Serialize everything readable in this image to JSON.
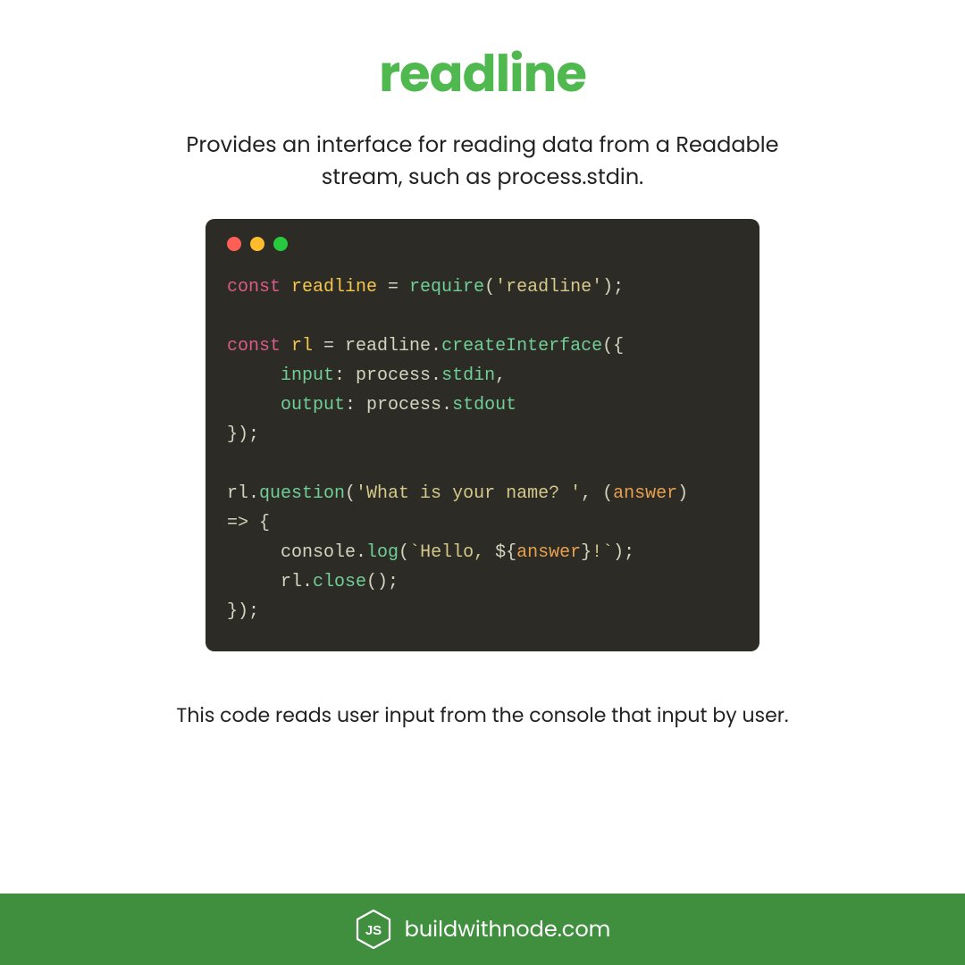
{
  "title": "readline",
  "subtitle": "Provides an interface for reading data from a Readable stream, such as process.stdin.",
  "caption": "This code reads user input from the console that input by user.",
  "footer": {
    "text": "buildwithnode.com"
  },
  "code": {
    "l1_const": "const ",
    "l1_var": "readline",
    "l1_eq": " = ",
    "l1_fn": "require",
    "l1_open": "(",
    "l1_str": "'readline'",
    "l1_close": ");",
    "l3_const": "const ",
    "l3_var": "rl",
    "l3_eq": " = readline.",
    "l3_fn": "createInterface",
    "l3_open": "({",
    "l4_indent": "     ",
    "l4_key": "input",
    "l4_colon": ": process.",
    "l4_prop": "stdin",
    "l4_comma": ",",
    "l5_indent": "     ",
    "l5_key": "output",
    "l5_colon": ": process.",
    "l5_prop": "stdout",
    "l6_close": "});",
    "l8_obj": "rl.",
    "l8_fn": "question",
    "l8_open": "(",
    "l8_str": "'What is your name? '",
    "l8_comma": ", (",
    "l8_param": "answer",
    "l8_close": ")",
    "l9_arrow": "=> {",
    "l10_indent": "     console.",
    "l10_fn": "log",
    "l10_open": "(",
    "l10_str1": "`Hello, ",
    "l10_interp_open": "${",
    "l10_interp_var": "answer",
    "l10_interp_close": "}",
    "l10_str2": "!`",
    "l10_close": ");",
    "l11_indent": "     rl.",
    "l11_fn": "close",
    "l11_call": "();",
    "l12_close": "});"
  }
}
